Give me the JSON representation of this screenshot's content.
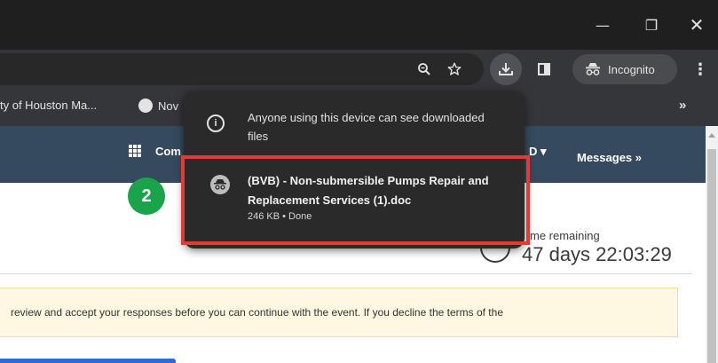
{
  "browser": {
    "window_controls": {
      "minimize": "—",
      "restore": "❐",
      "close": "✕"
    },
    "toolbar": {
      "zoom_icon": "zoom-icon",
      "star_icon": "bookmark-star-icon",
      "download_icon": "download-icon",
      "side_panel_icon": "side-panel-icon",
      "incognito_label": "Incognito",
      "menu_icon": "⋮"
    },
    "bookmarks": {
      "item1": "ty of Houston Ma...",
      "item2": "Nov",
      "more": "»"
    }
  },
  "downloads_bubble": {
    "info": "Anyone using this device can see downloaded files",
    "file_name": "(BVB) - Non-submersible Pumps Repair and Replacement Services (1).doc",
    "file_status": "246 KB • Done"
  },
  "annotation": {
    "step": "2",
    "highlight_color": "#e53935",
    "badge_color": "#1aa34a"
  },
  "page": {
    "nav": {
      "comp": "Com",
      "dropdown": "D ▾",
      "messages": "Messages »"
    },
    "time_label": "me remaining",
    "time_value": "47 days 22:03:29",
    "warning_text": "review and accept your responses before you can continue with the event. If you decline the terms of the"
  },
  "colors": {
    "titlebar": "#1f1f1f",
    "toolbar": "#35363a",
    "nav": "#354a5f",
    "bubble": "#2a2a2a",
    "warning_bg": "#fef7e1"
  }
}
